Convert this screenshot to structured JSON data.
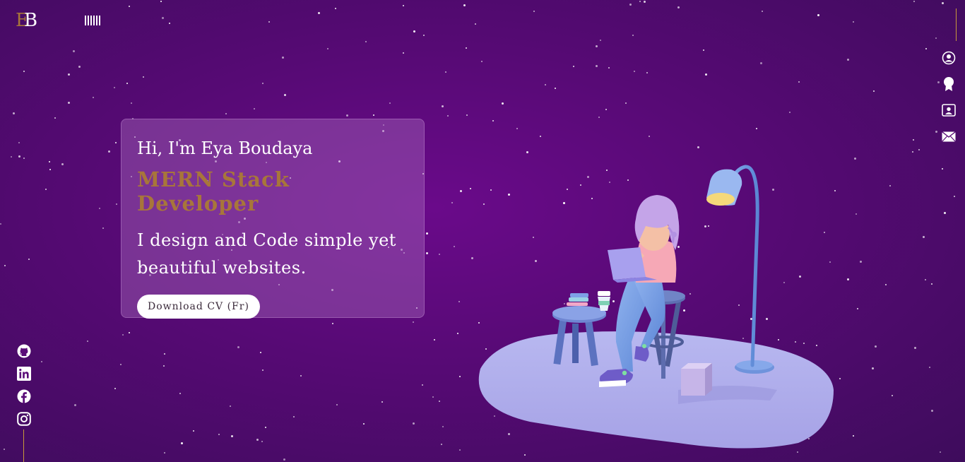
{
  "logo": {
    "letter_1": "E",
    "letter_2": "B"
  },
  "menu": {
    "icon": "menu-bars-icon"
  },
  "hero": {
    "greeting": "Hi, I'm Eya Boudaya",
    "role": "MERN Stack Developer",
    "tagline": "I design and Code simple yet beautiful websites.",
    "cv_button": "Download CV (Fr)"
  },
  "right_nav": [
    {
      "icon": "user-circle-icon"
    },
    {
      "icon": "award-icon"
    },
    {
      "icon": "contact-card-icon"
    },
    {
      "icon": "envelope-icon"
    }
  ],
  "social": [
    {
      "icon": "github-icon"
    },
    {
      "icon": "linkedin-icon"
    },
    {
      "icon": "facebook-icon"
    },
    {
      "icon": "instagram-icon"
    }
  ],
  "colors": {
    "accent": "#a8763a",
    "background": "#560a74",
    "text": "#ffffff"
  }
}
